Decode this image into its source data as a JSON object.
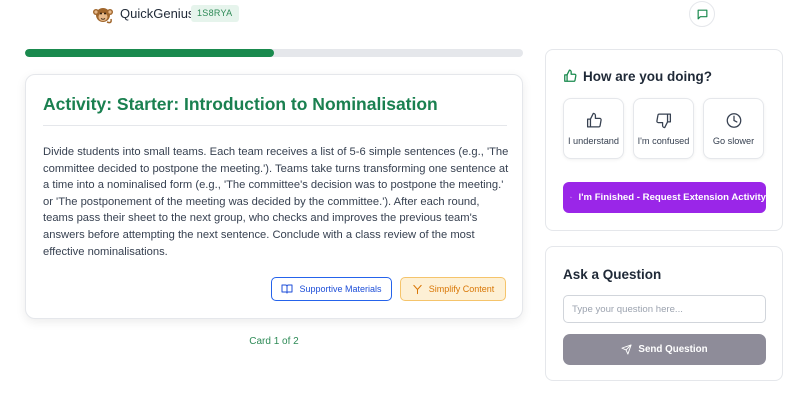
{
  "header": {
    "brand": "QuickGenius",
    "session_code": "1S8RYA"
  },
  "progress": {
    "fraction": 0.5
  },
  "activity": {
    "title": "Activity: Starter: Introduction to Nominalisation",
    "body": "Divide students into small teams. Each team receives a list of 5-6 simple sentences (e.g., 'The committee decided to postpone the meeting.'). Teams take turns transforming one sentence at a time into a nominalised form (e.g., 'The committee's decision was to postpone the meeting.' or 'The postponement of the meeting was decided by the committee.'). After each round, teams pass their sheet to the next group, who checks and improves the previous team's answers before attempting the next sentence. Conclude with a class review of the most effective nominalisations.",
    "supportive_label": "Supportive Materials",
    "simplify_label": "Simplify Content",
    "counter": "Card 1 of 2"
  },
  "feedback": {
    "title": "How are you doing?",
    "options": [
      {
        "label": "I understand",
        "icon": "thumbs-up-icon"
      },
      {
        "label": "I'm confused",
        "icon": "thumbs-down-icon"
      },
      {
        "label": "Go slower",
        "icon": "clock-icon"
      }
    ],
    "finish_label": "I'm Finished - Request Extension Activity"
  },
  "ask": {
    "title": "Ask a Question",
    "placeholder": "Type your question here...",
    "value": "",
    "send_label": "Send Question"
  },
  "colors": {
    "accent_green": "#1a8050",
    "progress_green": "#1a8a4e",
    "finish_purple": "#9a26e8",
    "support_blue": "#2563eb",
    "simplify_amber": "#d97706",
    "send_gray": "#8e8c99"
  }
}
